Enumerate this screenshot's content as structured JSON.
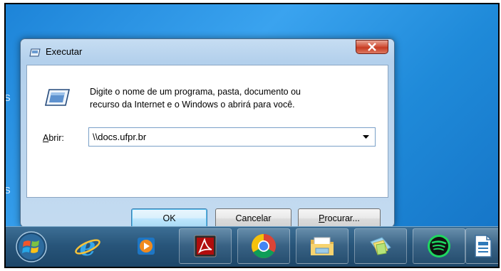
{
  "dialog": {
    "title": "Executar",
    "close_glyph": "x",
    "description_line1": "Digite o nome de um programa, pasta, documento ou",
    "description_line2": "recurso da Internet e o Windows o abrirá para você.",
    "open_label_accel": "A",
    "open_label_rest": "brir:",
    "open_value": "\\\\docs.ufpr.br",
    "buttons": {
      "ok": "OK",
      "cancel": "Cancelar",
      "browse_accel": "P",
      "browse_rest": "rocurar..."
    }
  },
  "desktop": {
    "edge_glyphs": [
      "S",
      "S",
      "S"
    ]
  },
  "taskbar": {
    "icons": [
      "windows-start-icon",
      "internet-explorer-icon",
      "media-player-icon",
      "adobe-reader-icon",
      "chrome-icon",
      "file-explorer-icon",
      "sticky-notes-icon",
      "spotify-icon",
      "writer-document-icon"
    ]
  },
  "colors": {
    "accent": "#3b9be6",
    "close_red": "#c73b22",
    "taskbar": "#28557a"
  }
}
